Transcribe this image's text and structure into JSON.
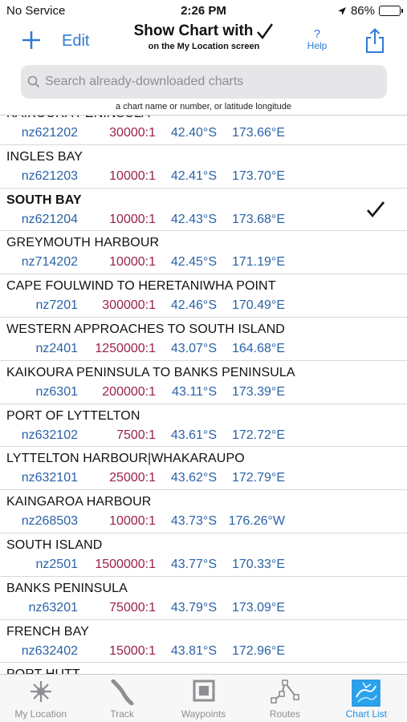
{
  "status": {
    "carrier": "No Service",
    "time": "2:26 PM",
    "battery": "86%",
    "battery_level": 0.86
  },
  "nav": {
    "add_icon": "plus-icon",
    "edit_label": "Edit",
    "title": "Show Chart with",
    "title_icon": "checkmark-icon",
    "subtitle": "on the My Location screen",
    "help_glyph": "?",
    "help_label": "Help",
    "share_icon": "share-icon"
  },
  "search": {
    "placeholder": "Search already-downloaded charts",
    "value": "",
    "hint": "a chart name or number, or latitude longitude"
  },
  "charts": [
    {
      "name": "KAIKOURA PENINSULA",
      "code": "nz621202",
      "scale": "30000:1",
      "lat": "42.40°S",
      "lon": "173.66°E",
      "selected": false
    },
    {
      "name": "INGLES BAY",
      "code": "nz621203",
      "scale": "10000:1",
      "lat": "42.41°S",
      "lon": "173.70°E",
      "selected": false
    },
    {
      "name": "SOUTH BAY",
      "code": "nz621204",
      "scale": "10000:1",
      "lat": "42.43°S",
      "lon": "173.68°E",
      "selected": true
    },
    {
      "name": "GREYMOUTH HARBOUR",
      "code": "nz714202",
      "scale": "10000:1",
      "lat": "42.45°S",
      "lon": "171.19°E",
      "selected": false
    },
    {
      "name": "CAPE FOULWIND TO HERETANIWHA POINT",
      "code": "nz7201",
      "scale": "300000:1",
      "lat": "42.46°S",
      "lon": "170.49°E",
      "selected": false
    },
    {
      "name": "WESTERN APPROACHES TO SOUTH ISLAND",
      "code": "nz2401",
      "scale": "1250000:1",
      "lat": "43.07°S",
      "lon": "164.68°E",
      "selected": false
    },
    {
      "name": "KAIKOURA PENINSULA TO BANKS PENINSULA",
      "code": "nz6301",
      "scale": "200000:1",
      "lat": "43.11°S",
      "lon": "173.39°E",
      "selected": false
    },
    {
      "name": "PORT OF LYTTELTON",
      "code": "nz632102",
      "scale": "7500:1",
      "lat": "43.61°S",
      "lon": "172.72°E",
      "selected": false
    },
    {
      "name": "LYTTELTON HARBOUR|WHAKARAUPO",
      "code": "nz632101",
      "scale": "25000:1",
      "lat": "43.62°S",
      "lon": "172.79°E",
      "selected": false
    },
    {
      "name": "KAINGAROA HARBOUR",
      "code": "nz268503",
      "scale": "10000:1",
      "lat": "43.73°S",
      "lon": "176.26°W",
      "selected": false
    },
    {
      "name": "SOUTH ISLAND",
      "code": "nz2501",
      "scale": "1500000:1",
      "lat": "43.77°S",
      "lon": "170.33°E",
      "selected": false
    },
    {
      "name": "BANKS PENINSULA",
      "code": "nz63201",
      "scale": "75000:1",
      "lat": "43.79°S",
      "lon": "173.09°E",
      "selected": false
    },
    {
      "name": "FRENCH BAY",
      "code": "nz632402",
      "scale": "15000:1",
      "lat": "43.81°S",
      "lon": "172.96°E",
      "selected": false
    },
    {
      "name": "PORT HUTT",
      "code": "",
      "scale": "",
      "lat": "",
      "lon": "",
      "selected": false
    }
  ],
  "tabs": [
    {
      "label": "My Location",
      "icon": "sun-icon",
      "active": false
    },
    {
      "label": "Track",
      "icon": "track-icon",
      "active": false
    },
    {
      "label": "Waypoints",
      "icon": "waypoint-icon",
      "active": false
    },
    {
      "label": "Routes",
      "icon": "route-icon",
      "active": false
    },
    {
      "label": "Chart List",
      "icon": "chart-list-icon",
      "active": true
    }
  ],
  "colors": {
    "accent": "#2f7ad6",
    "scale": "#9a2146",
    "coord": "#2a62a8",
    "tab_active": "#1f8fe0",
    "tab_inactive": "#8e8e93"
  }
}
